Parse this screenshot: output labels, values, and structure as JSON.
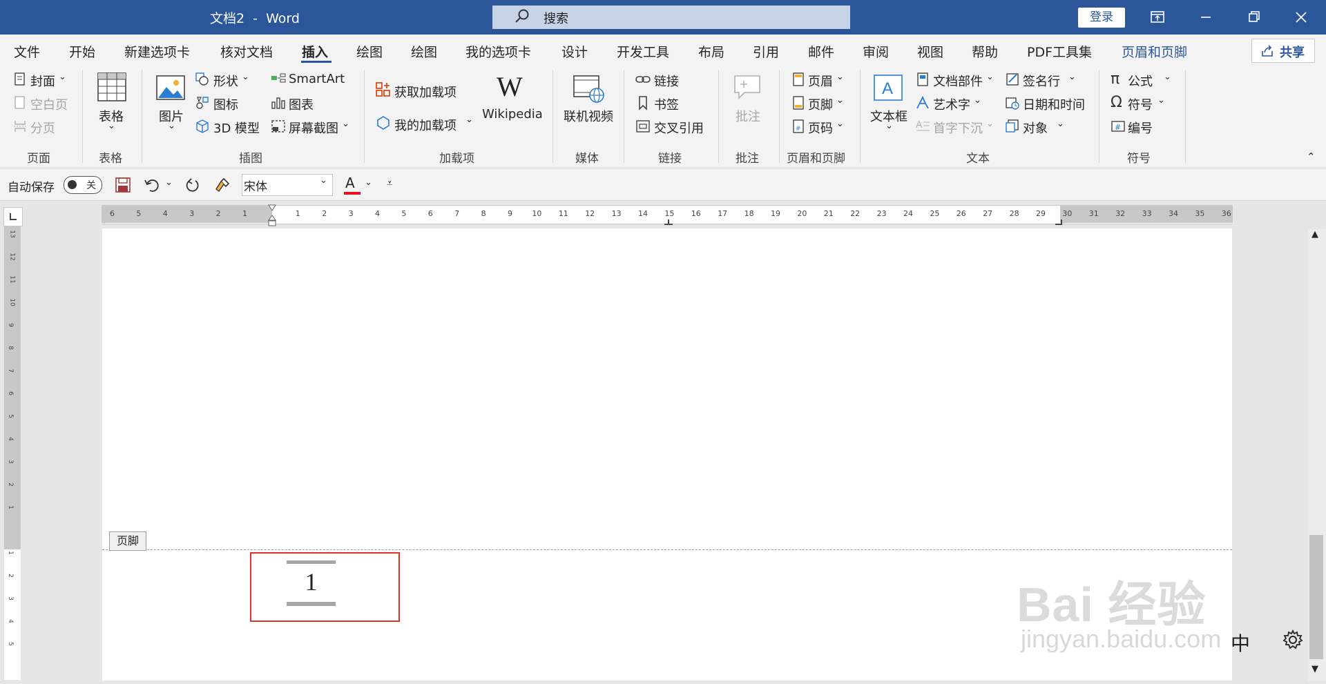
{
  "window": {
    "title": "文档2  -  Word",
    "search_placeholder": "搜索",
    "login_label": "登录"
  },
  "tabs": [
    "文件",
    "开始",
    "新建选项卡",
    "核对文档",
    "插入",
    "绘图",
    "绘图",
    "我的选项卡",
    "设计",
    "开发工具",
    "布局",
    "引用",
    "邮件",
    "审阅",
    "视图",
    "帮助",
    "PDF工具集",
    "页眉和页脚"
  ],
  "active_tab": "插入",
  "share_label": "共享",
  "ribbon": {
    "page": {
      "items": [
        "封面",
        "空白页",
        "分页"
      ],
      "group": "页面"
    },
    "table": {
      "label": "表格",
      "group": "表格"
    },
    "illustrations": {
      "picture": "图片",
      "shapes": "形状",
      "icons": "图标",
      "model3d": "3D 模型",
      "smartart": "SmartArt",
      "chart": "图表",
      "screenshot": "屏幕截图",
      "group": "插图"
    },
    "addins": {
      "get": "获取加载项",
      "mine": "我的加载项",
      "wikipedia": "Wikipedia",
      "group": "加载项"
    },
    "media": {
      "online_video": "联机视频",
      "group": "媒体"
    },
    "links": {
      "link": "链接",
      "bookmark": "书签",
      "cross_ref": "交叉引用",
      "group": "链接"
    },
    "comments": {
      "comment": "批注",
      "group": "批注"
    },
    "header_footer": {
      "header": "页眉",
      "footer": "页脚",
      "page_number": "页码",
      "group": "页眉和页脚"
    },
    "text": {
      "textbox": "文本框",
      "quick_parts": "文档部件",
      "wordart": "艺术字",
      "drop_cap": "首字下沉",
      "signature": "签名行",
      "datetime": "日期和时间",
      "object": "对象",
      "group": "文本"
    },
    "symbols": {
      "equation": "公式",
      "symbol": "符号",
      "number": "编号",
      "group": "符号"
    }
  },
  "qat": {
    "autosave_label": "自动保存",
    "autosave_state": "关",
    "font_name": "宋体",
    "font_color": "#e81123"
  },
  "hruler_ticks": [
    "6",
    "5",
    "4",
    "3",
    "2",
    "1",
    "",
    "1",
    "2",
    "3",
    "4",
    "5",
    "6",
    "7",
    "8",
    "9",
    "10",
    "11",
    "12",
    "13",
    "14",
    "15",
    "16",
    "17",
    "18",
    "19",
    "20",
    "21",
    "22",
    "23",
    "24",
    "25",
    "26",
    "27",
    "28",
    "29",
    "30",
    "31",
    "32",
    "33",
    "34",
    "35",
    "36"
  ],
  "vruler_ticks": [
    "13",
    "12",
    "11",
    "10",
    "9",
    "8",
    "7",
    "6",
    "5",
    "4",
    "3",
    "2",
    "1",
    "",
    "1",
    "2",
    "3",
    "4",
    "5"
  ],
  "document": {
    "footer_tag": "页脚",
    "page_number": "1"
  },
  "ime": {
    "mode": "中"
  },
  "watermark": {
    "main": "Bai 经验",
    "sub": "jingyan.baidu.com"
  },
  "colors": {
    "accent": "#2b579a",
    "highlight_border": "#e8302a"
  }
}
